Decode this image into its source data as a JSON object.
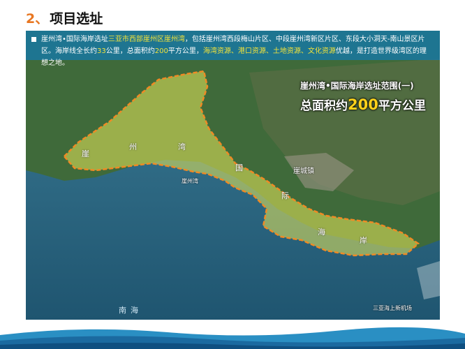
{
  "heading": {
    "number": "2、",
    "title": "项目选址"
  },
  "intro": {
    "p1": "崖州湾•国际海岸选址",
    "p2": "三亚市西部崖州区崖州湾",
    "p3": "，包括崖州湾西段梅山片区、中段崖州湾新区片区、东段大小洞天-南山景区片区。海岸线全长约",
    "p4": "33",
    "p5": "公里，总面积约",
    "p6": "200",
    "p7": "平方公里，",
    "p8": "海湾资源、港口资源、土地资源、文化资源",
    "p9": "优越，是打造世界级湾区的理想之地。"
  },
  "map": {
    "title_line1": "崖州湾•国际海岸选址范围(一)",
    "area_prefix": "总面积约",
    "area_value": "200",
    "area_unit": "平方公里",
    "zone_chars": [
      "崖",
      "州",
      "湾",
      "国",
      "际",
      "海",
      "岸"
    ],
    "town_label": "崖城镇",
    "bay_label": "崖州湾",
    "sea_label": "南海",
    "airport_label": "三亚海上新机场"
  },
  "colors": {
    "accent_orange": "#e87722",
    "highlight_yellow": "#f2e23a",
    "zone_fill": "#e8e85a"
  }
}
